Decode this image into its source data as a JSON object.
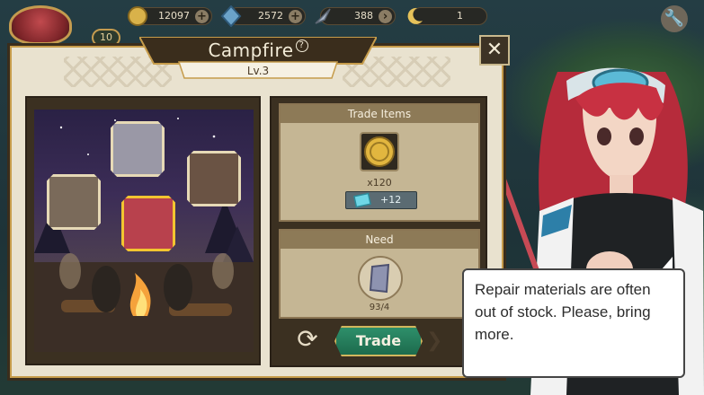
{
  "resources": [
    {
      "name": "gold-coin",
      "value": "12097",
      "color": "#d9b24a"
    },
    {
      "name": "blue-crystal",
      "value": "2572",
      "color": "#6ba3c9"
    },
    {
      "name": "feather",
      "value": "388",
      "color": "#a8b4c4"
    },
    {
      "name": "moon",
      "value": "1",
      "color": "#e6c25a"
    }
  ],
  "player": {
    "level": "10"
  },
  "dialog": {
    "title": "Campfire",
    "level": "Lv.3",
    "close_icon": "close-icon",
    "help_icon": "help-icon"
  },
  "trade_items": {
    "header": "Trade Items",
    "reward_icon": "gold-coin-icon",
    "reward_count": "x120",
    "bonus": "+12"
  },
  "need": {
    "header": "Need",
    "item_icon": "repair-material-icon",
    "count": "93/4"
  },
  "buttons": {
    "trade_label": "Trade",
    "refresh_icon": "refresh-icon"
  },
  "speech": {
    "text": "Repair materials are often out of stock. Please, bring more."
  },
  "colors": {
    "frame_dark": "#3a2d1c",
    "accent_gold": "#c69c4b",
    "trade_green": "#1d6b4d",
    "parchment": "#e9e2cf"
  }
}
